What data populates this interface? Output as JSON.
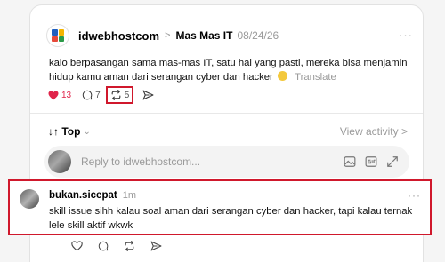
{
  "post": {
    "username": "idwebhostcom",
    "separator": ">",
    "channel": "Mas Mas IT",
    "date": "08/24/26",
    "more": "···",
    "text": "kalo berpasangan sama mas-mas IT, satu hal yang pasti, mereka bisa menjamin hidup kamu aman dari serangan cyber dan hacker",
    "translate": "Translate",
    "likes": "13",
    "comments": "7",
    "reposts": "5"
  },
  "sort": {
    "label": "↓↑ Top",
    "chevron": "⌄",
    "view_activity": "View activity >"
  },
  "reply": {
    "placeholder": "Reply to idwebhostcom..."
  },
  "comment": {
    "username": "bukan.sicepat",
    "time": "1m",
    "more": "···",
    "text": "skill issue sihh kalau soal aman dari serangan cyber dan hacker, tapi kalau ternak lele skill aktif wkwk"
  },
  "colors": {
    "like": "#e0244a",
    "highlight": "#d0182c",
    "muted": "#9a9a9a"
  }
}
